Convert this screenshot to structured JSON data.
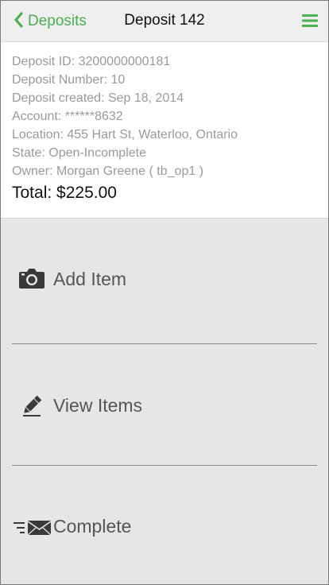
{
  "header": {
    "back_label": "Deposits",
    "title": "Deposit 142",
    "accent_color": "#4caf50",
    "back_icon": "chevron-left-icon",
    "menu_icon": "hamburger-menu-icon"
  },
  "deposit": {
    "id_line": "Deposit ID: 3200000000181",
    "number_line": "Deposit Number: 10",
    "created_line": "Deposit created: Sep 18, 2014",
    "account_line": "Account: ******8632",
    "location_line": "Location: 455 Hart St, Waterloo, Ontario",
    "state_line": "State: Open-Incomplete",
    "owner_line": "Owner: Morgan Greene ( tb_op1 )",
    "total_line": "Total: $225.00"
  },
  "actions": {
    "add_item": {
      "label": "Add Item",
      "icon": "camera-icon"
    },
    "view_items": {
      "label": "View Items",
      "icon": "pencil-icon"
    },
    "complete": {
      "label": "Complete",
      "icon": "send-mail-icon"
    }
  }
}
